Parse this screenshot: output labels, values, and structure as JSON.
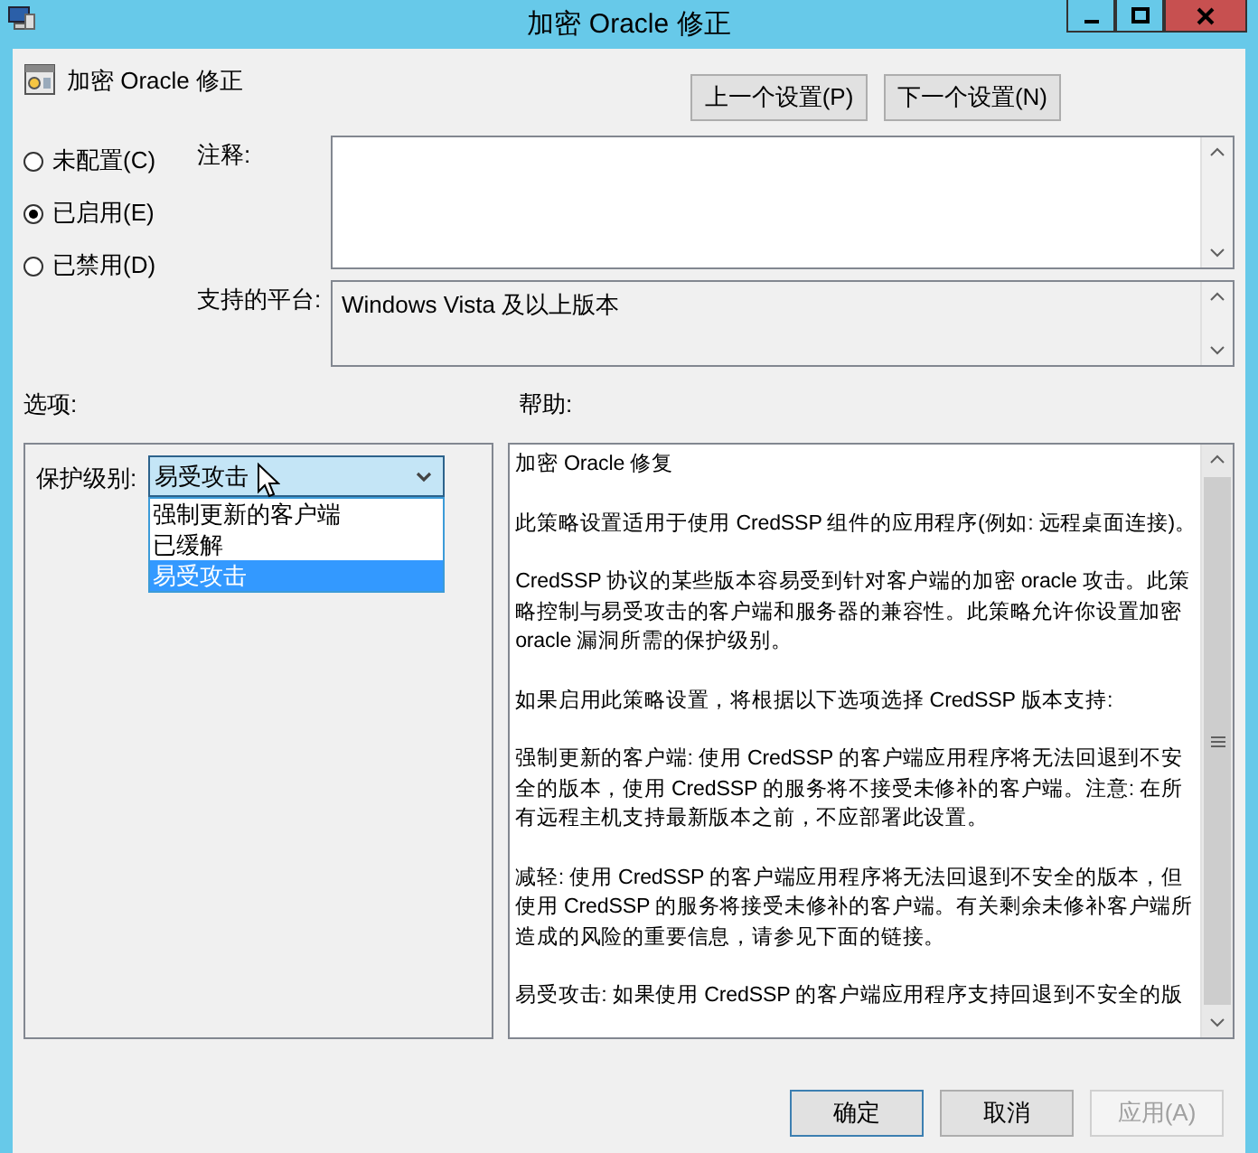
{
  "window": {
    "title": "加密 Oracle 修正"
  },
  "header": {
    "title": "加密 Oracle 修正",
    "nav_buttons": [
      "上一个设置(P)",
      "下一个设置(N)"
    ]
  },
  "state_options": [
    {
      "label": "未配置(C)",
      "selected": false
    },
    {
      "label": "已启用(E)",
      "selected": true
    },
    {
      "label": "已禁用(D)",
      "selected": false
    }
  ],
  "comment": {
    "label": "注释:"
  },
  "platform": {
    "label": "支持的平台:",
    "value": "Windows Vista 及以上版本"
  },
  "options": {
    "label": "选项:",
    "protection_label": "保护级别:",
    "dropdown": {
      "value": "易受攻击",
      "expanded": true,
      "items": [
        {
          "label": "强制更新的客户端",
          "selected": false
        },
        {
          "label": "已缓解",
          "selected": false
        },
        {
          "label": "易受攻击",
          "selected": true
        }
      ]
    }
  },
  "help": {
    "label": "帮助:",
    "paragraphs": [
      "加密 Oracle 修复",
      "此策略设置适用于使用 CredSSP 组件的应用程序(例如: 远程桌面连接)。",
      "CredSSP 协议的某些版本容易受到针对客户端的加密 oracle 攻击。此策略控制与易受攻击的客户端和服务器的兼容性。此策略允许你设置加密 oracle 漏洞所需的保护级别。",
      "如果启用此策略设置，将根据以下选项选择 CredSSP 版本支持:",
      "强制更新的客户端: 使用 CredSSP 的客户端应用程序将无法回退到不安全的版本，使用 CredSSP 的服务将不接受未修补的客户端。注意: 在所有远程主机支持最新版本之前，不应部署此设置。",
      "减轻: 使用 CredSSP 的客户端应用程序将无法回退到不安全的版本，但使用 CredSSP 的服务将接受未修补的客户端。有关剩余未修补客户端所造成的风险的重要信息，请参见下面的链接。",
      "易受攻击: 如果使用 CredSSP 的客户端应用程序支持回退到不安全的版"
    ]
  },
  "footer_buttons": [
    {
      "label": "确定",
      "disabled": false
    },
    {
      "label": "取消",
      "disabled": false
    },
    {
      "label": "应用(A)",
      "disabled": true
    }
  ]
}
